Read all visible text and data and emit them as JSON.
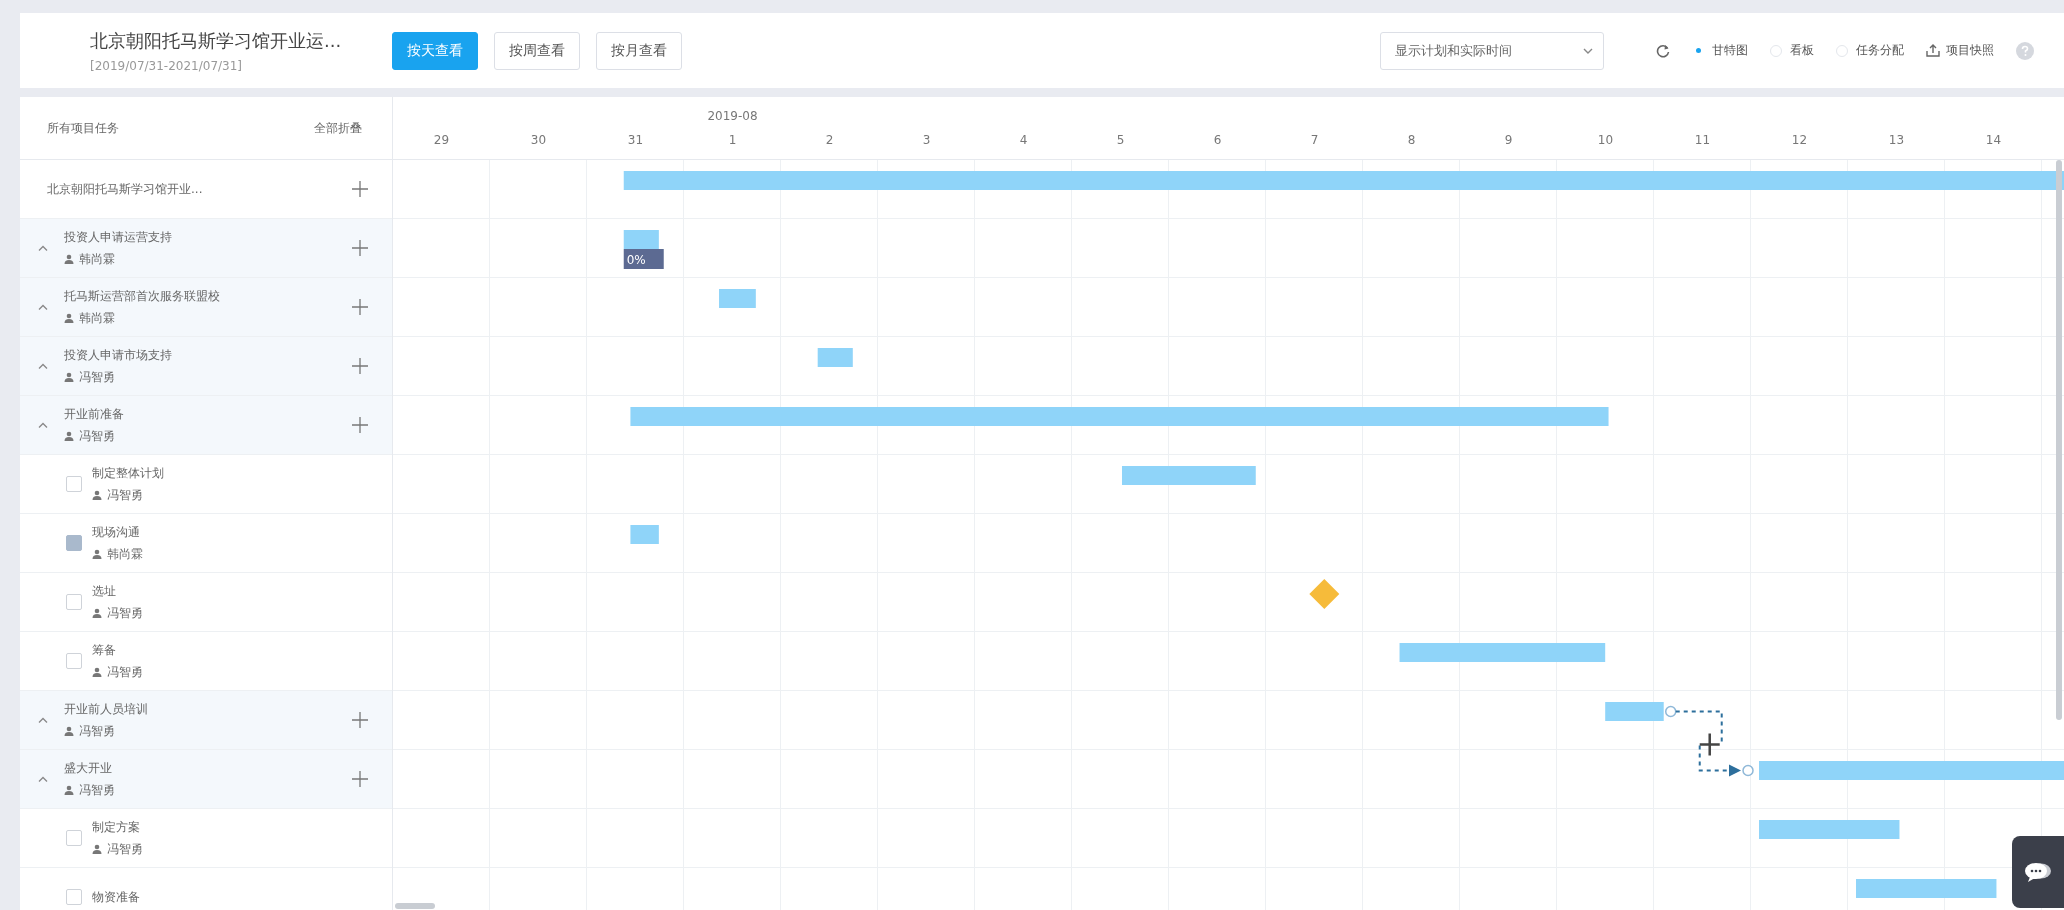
{
  "header": {
    "title": "北京朝阳托马斯学习馆开业运...",
    "date_range": "[2019/07/31-2021/07/31]",
    "views": [
      {
        "label": "按天查看",
        "selected": true
      },
      {
        "label": "按周查看",
        "selected": false
      },
      {
        "label": "按月查看",
        "selected": false
      }
    ],
    "display_select": {
      "value": "显示计划和实际时间"
    },
    "modes": [
      {
        "label": "甘特图",
        "selected": true
      },
      {
        "label": "看板",
        "selected": false
      },
      {
        "label": "任务分配",
        "selected": false
      }
    ],
    "snapshot": {
      "label": "项目快照"
    }
  },
  "task_list": {
    "heading": "所有项目任务",
    "collapse_all": "全部折叠"
  },
  "timeline": {
    "days": [
      {
        "label": "29"
      },
      {
        "label": "30"
      },
      {
        "label": "31"
      },
      {
        "label": "1",
        "month": "2019-08"
      },
      {
        "label": "2"
      },
      {
        "label": "3"
      },
      {
        "label": "4"
      },
      {
        "label": "5"
      },
      {
        "label": "6"
      },
      {
        "label": "7"
      },
      {
        "label": "8"
      },
      {
        "label": "9"
      },
      {
        "label": "10"
      },
      {
        "label": "11"
      },
      {
        "label": "12"
      },
      {
        "label": "13"
      },
      {
        "label": "14"
      }
    ]
  },
  "rows": [
    {
      "kind": "project",
      "title": "北京朝阳托马斯学习馆开业...",
      "bar": {
        "kind": "bar"
      }
    },
    {
      "kind": "group",
      "title": "投资人申请运营支持",
      "assignee": "韩尚霖",
      "expanded": true,
      "bar": {
        "kind": "bar",
        "progress_label": "0%"
      }
    },
    {
      "kind": "group",
      "title": "托马斯运营部首次服务联盟校",
      "assignee": "韩尚霖",
      "expanded": true,
      "bar": {
        "kind": "bar"
      }
    },
    {
      "kind": "group",
      "title": "投资人申请市场支持",
      "assignee": "冯智勇",
      "expanded": true,
      "bar": {
        "kind": "bar"
      }
    },
    {
      "kind": "group",
      "title": "开业前准备",
      "assignee": "冯智勇",
      "expanded": true,
      "bar": {
        "kind": "bar"
      }
    },
    {
      "kind": "task",
      "title": "制定整体计划",
      "assignee": "冯智勇",
      "checked": false,
      "bar": {
        "kind": "bar"
      }
    },
    {
      "kind": "task",
      "title": "现场沟通",
      "assignee": "韩尚霖",
      "checked": true,
      "bar": {
        "kind": "bar"
      }
    },
    {
      "kind": "task",
      "title": "选址",
      "assignee": "冯智勇",
      "checked": false,
      "bar": {
        "kind": "milestone"
      }
    },
    {
      "kind": "task",
      "title": "筹备",
      "assignee": "冯智勇",
      "checked": false,
      "bar": {
        "kind": "bar"
      }
    },
    {
      "kind": "group",
      "title": "开业前人员培训",
      "assignee": "冯智勇",
      "expanded": true,
      "bar": {
        "kind": "bar",
        "link_to_next": true
      }
    },
    {
      "kind": "group",
      "title": "盛大开业",
      "assignee": "冯智勇",
      "expanded": true,
      "bar": {
        "kind": "bar"
      }
    },
    {
      "kind": "task",
      "title": "制定方案",
      "assignee": "冯智勇",
      "checked": false,
      "bar": {
        "kind": "bar"
      }
    },
    {
      "kind": "task",
      "title": "物资准备",
      "checked": false,
      "bar": {
        "kind": "bar"
      }
    }
  ]
}
